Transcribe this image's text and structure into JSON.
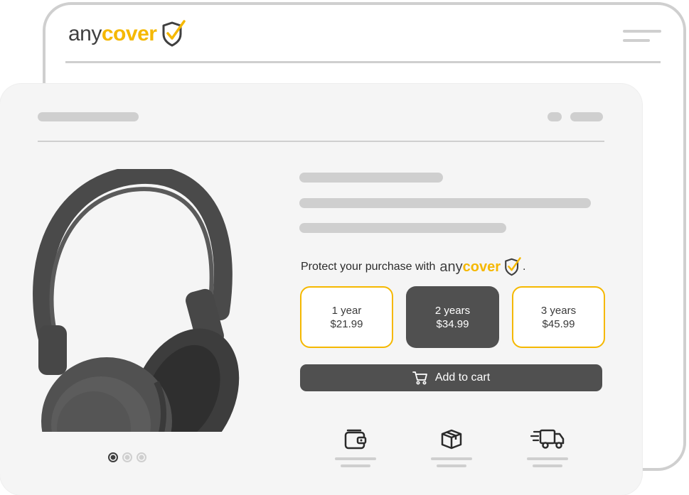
{
  "brand": {
    "any": "any",
    "cover": "cover",
    "accent_color": "#f5b800"
  },
  "front": {
    "protect_prefix": "Protect your purchase with",
    "protect_suffix": ".",
    "plans": [
      {
        "duration": "1 year",
        "price": "$21.99",
        "selected": false
      },
      {
        "duration": "2 years",
        "price": "$34.99",
        "selected": true
      },
      {
        "duration": "3 years",
        "price": "$45.99",
        "selected": false
      }
    ],
    "add_to_cart_label": "Add to cart",
    "carousel": {
      "slides": 3,
      "active_index": 0
    },
    "features": [
      "wallet-icon",
      "package-icon",
      "delivery-truck-icon"
    ]
  },
  "colors": {
    "dark": "#505050",
    "placeholder": "#cfcfcf",
    "card": "#f5f5f5"
  }
}
